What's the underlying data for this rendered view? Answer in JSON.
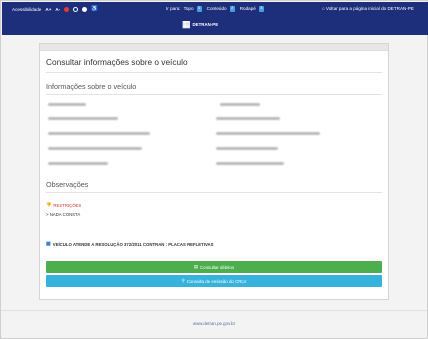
{
  "topbar": {
    "accessibility_label": "Acessibilidade",
    "font_increase": "A+",
    "font_decrease": "A-",
    "skip_label": "Ir para:",
    "skip_links": [
      {
        "label": "Topo",
        "key": "1"
      },
      {
        "label": "Conteúdo",
        "key": "2"
      },
      {
        "label": "Rodapé",
        "key": "3"
      }
    ],
    "home_link": "Voltar para a página inicial do DETRAN-PE",
    "colors": {
      "bar": "#1d2e7a",
      "contrast_a": "#e53935",
      "contrast_b": "#ffffff",
      "contrast_c": "#ffffff"
    }
  },
  "brand": {
    "name": "DETRAN-PE"
  },
  "panel": {
    "title": "Consultar informações sobre o veículo",
    "vehicle_section": "Informações sobre o veículo",
    "observations_section": "Observações",
    "restrictions_label": "RESTRIÇÕES",
    "restrictions_value": "> NADA CONSTA",
    "compliance_text": "VEÍCULO ATENDE A RESOLUÇÃO 372/2011 CONTRAN : PLACAS REFLETIVAS",
    "buttons": {
      "debts": "Consultar débitos",
      "crlv": "Consulta de emissão do CRLV"
    }
  },
  "footer": {
    "url": "www.detran.pe.gov.br"
  }
}
